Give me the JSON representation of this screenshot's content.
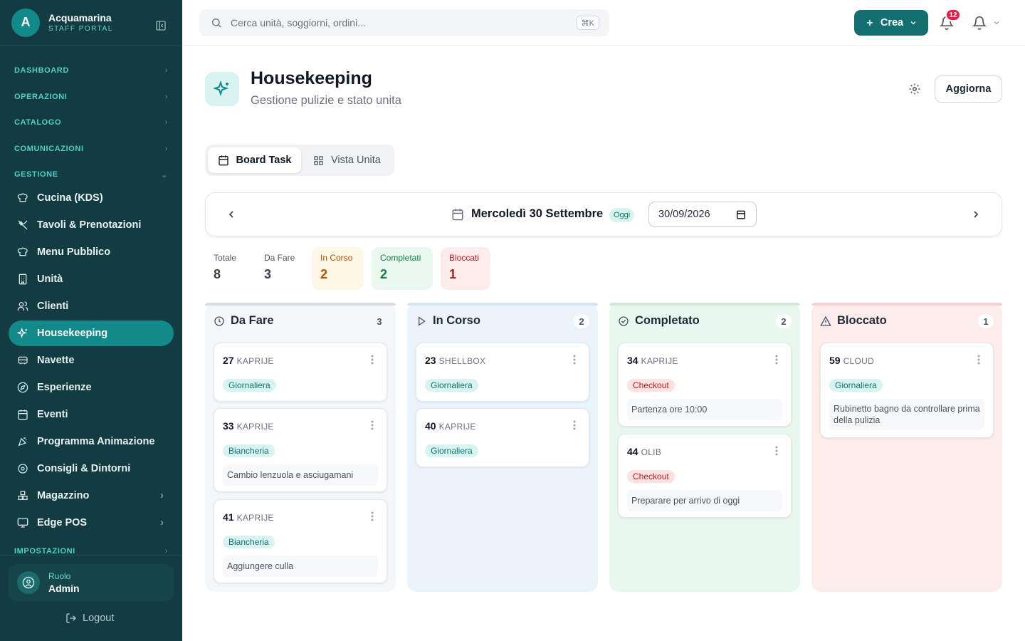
{
  "brand": {
    "logo_letter": "A",
    "name": "Acquamarina",
    "subtitle": "STAFF PORTAL"
  },
  "sidebar": {
    "sections": [
      "DASHBOARD",
      "OPERAZIONI",
      "CATALOGO",
      "COMUNICAZIONI",
      "GESTIONE",
      "IMPOSTAZIONI"
    ],
    "items": [
      {
        "label": "Cucina (KDS)",
        "icon": "chef-hat-icon"
      },
      {
        "label": "Tavoli & Prenotazioni",
        "icon": "utensils-icon"
      },
      {
        "label": "Menu Pubblico",
        "icon": "chef-hat-icon"
      },
      {
        "label": "Unità",
        "icon": "building-icon"
      },
      {
        "label": "Clienti",
        "icon": "users-icon"
      },
      {
        "label": "Housekeeping",
        "icon": "sparkles-icon",
        "active": true
      },
      {
        "label": "Navette",
        "icon": "bus-icon"
      },
      {
        "label": "Esperienze",
        "icon": "compass-icon"
      },
      {
        "label": "Eventi",
        "icon": "calendar-icon"
      },
      {
        "label": "Programma Animazione",
        "icon": "party-popper-icon"
      },
      {
        "label": "Consigli & Dintorni",
        "icon": "map-pin-icon"
      },
      {
        "label": "Magazzino",
        "icon": "boxes-icon"
      },
      {
        "label": "Edge POS",
        "icon": "monitor-icon"
      }
    ],
    "role_label": "Ruolo",
    "role_value": "Admin",
    "logout": "Logout"
  },
  "topbar": {
    "search_placeholder": "Cerca unità, soggiorni, ordini...",
    "shortcut": "⌘K",
    "create_label": "Crea",
    "notification_count": "12"
  },
  "page": {
    "title": "Housekeeping",
    "subtitle": "Gestione pulizie e stato unita",
    "refresh_label": "Aggiorna"
  },
  "tabs": [
    {
      "label": "Board Task"
    },
    {
      "label": "Vista Unita"
    }
  ],
  "date": {
    "label": "Mercoledì 30 Settembre",
    "today_badge": "Oggi",
    "input_value": "30/09/2026"
  },
  "stats": [
    {
      "label": "Totale",
      "value": "8"
    },
    {
      "label": "Da Fare",
      "value": "3"
    },
    {
      "label": "In Corso",
      "value": "2"
    },
    {
      "label": "Completati",
      "value": "2"
    },
    {
      "label": "Bloccati",
      "value": "1"
    }
  ],
  "columns": [
    {
      "title": "Da Fare",
      "count": "3",
      "cards": [
        {
          "unit": "27",
          "site": "KAPRIJE",
          "tag": "Giornaliera",
          "note": ""
        },
        {
          "unit": "33",
          "site": "KAPRIJE",
          "tag": "Biancheria",
          "note": "Cambio lenzuola e asciugamani"
        },
        {
          "unit": "41",
          "site": "KAPRIJE",
          "tag": "Biancheria",
          "note": "Aggiungere culla"
        }
      ]
    },
    {
      "title": "In Corso",
      "count": "2",
      "cards": [
        {
          "unit": "23",
          "site": "SHELLBOX",
          "tag": "Giornaliera",
          "note": ""
        },
        {
          "unit": "40",
          "site": "KAPRIJE",
          "tag": "Giornaliera",
          "note": ""
        }
      ]
    },
    {
      "title": "Completato",
      "count": "2",
      "cards": [
        {
          "unit": "34",
          "site": "KAPRIJE",
          "tag": "Checkout",
          "note": "Partenza ore 10:00"
        },
        {
          "unit": "44",
          "site": "OLIB",
          "tag": "Checkout",
          "note": "Preparare per arrivo di oggi"
        }
      ]
    },
    {
      "title": "Bloccato",
      "count": "1",
      "cards": [
        {
          "unit": "59",
          "site": "CLOUD",
          "tag": "Giornaliera",
          "note": "Rubinetto bagno da controllare prima della pulizia"
        }
      ]
    }
  ],
  "colors": {
    "sidebar_bg": "#123c42",
    "accent": "#138a8a",
    "primary_button": "#146f70",
    "todo_bg": "#f2f6fa",
    "inprogress_bg": "#eaf3fb",
    "done_bg": "#e9f8ef",
    "blocked_bg": "#fdecec",
    "badge_red": "#e11d48"
  }
}
